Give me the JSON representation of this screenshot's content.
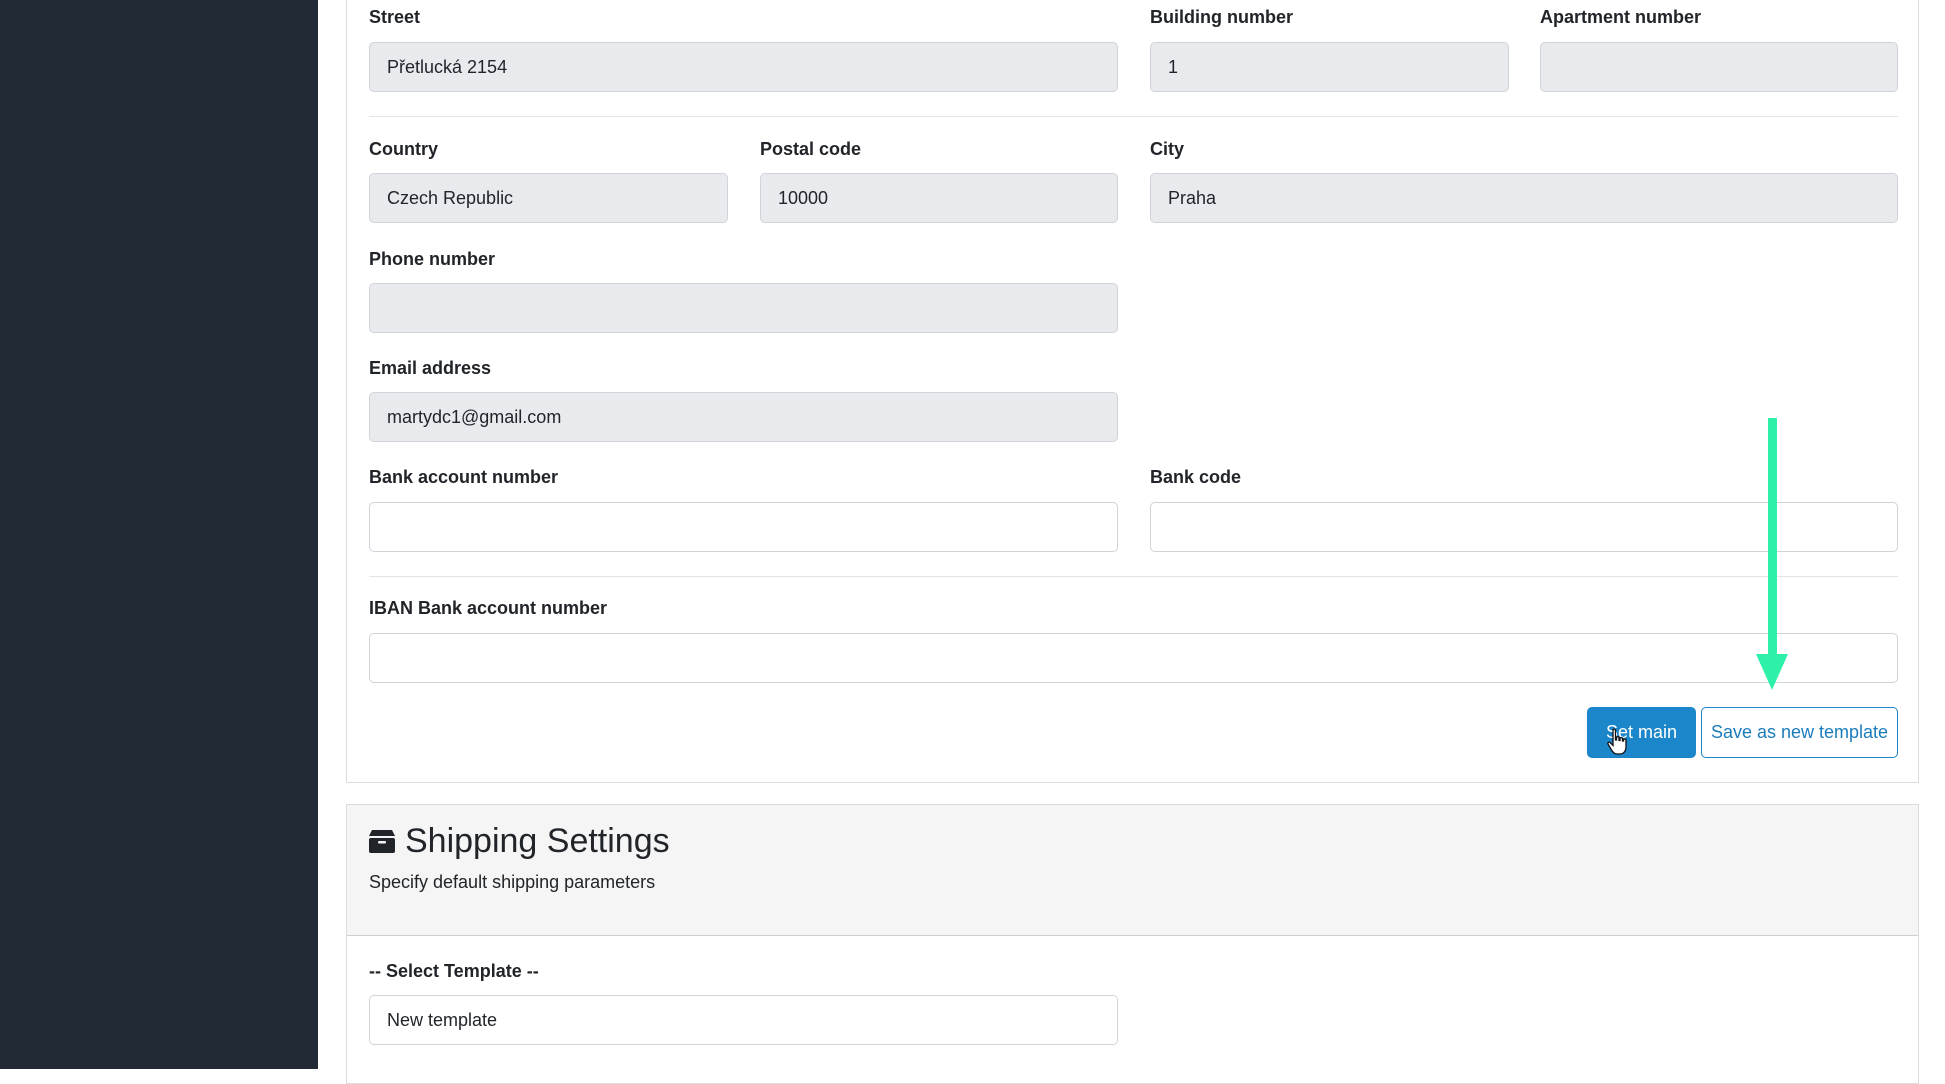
{
  "address": {
    "street_label": "Street",
    "street_value": "Přetlucká 2154",
    "building_label": "Building number",
    "building_value": "1",
    "apartment_label": "Apartment number",
    "apartment_value": "",
    "country_label": "Country",
    "country_value": "Czech Republic",
    "postal_label": "Postal code",
    "postal_value": "10000",
    "city_label": "City",
    "city_value": "Praha",
    "phone_label": "Phone number",
    "phone_value": "",
    "email_label": "Email address",
    "email_value": "martydc1@gmail.com"
  },
  "bank": {
    "account_label": "Bank account number",
    "account_value": "",
    "code_label": "Bank code",
    "code_value": "",
    "iban_label": "IBAN Bank account number",
    "iban_value": ""
  },
  "actions": {
    "set_main_label": "Set main",
    "save_template_label": "Save as new template"
  },
  "shipping": {
    "icon": "box-icon",
    "title": "Shipping Settings",
    "subtitle": "Specify default shipping parameters",
    "select_label": "-- Select Template --",
    "select_value": "New template"
  },
  "colors": {
    "sidebar": "#212a35",
    "accent": "#1b86c9",
    "arrow": "#2ff0a8",
    "input_readonly": "#e9eaed"
  }
}
